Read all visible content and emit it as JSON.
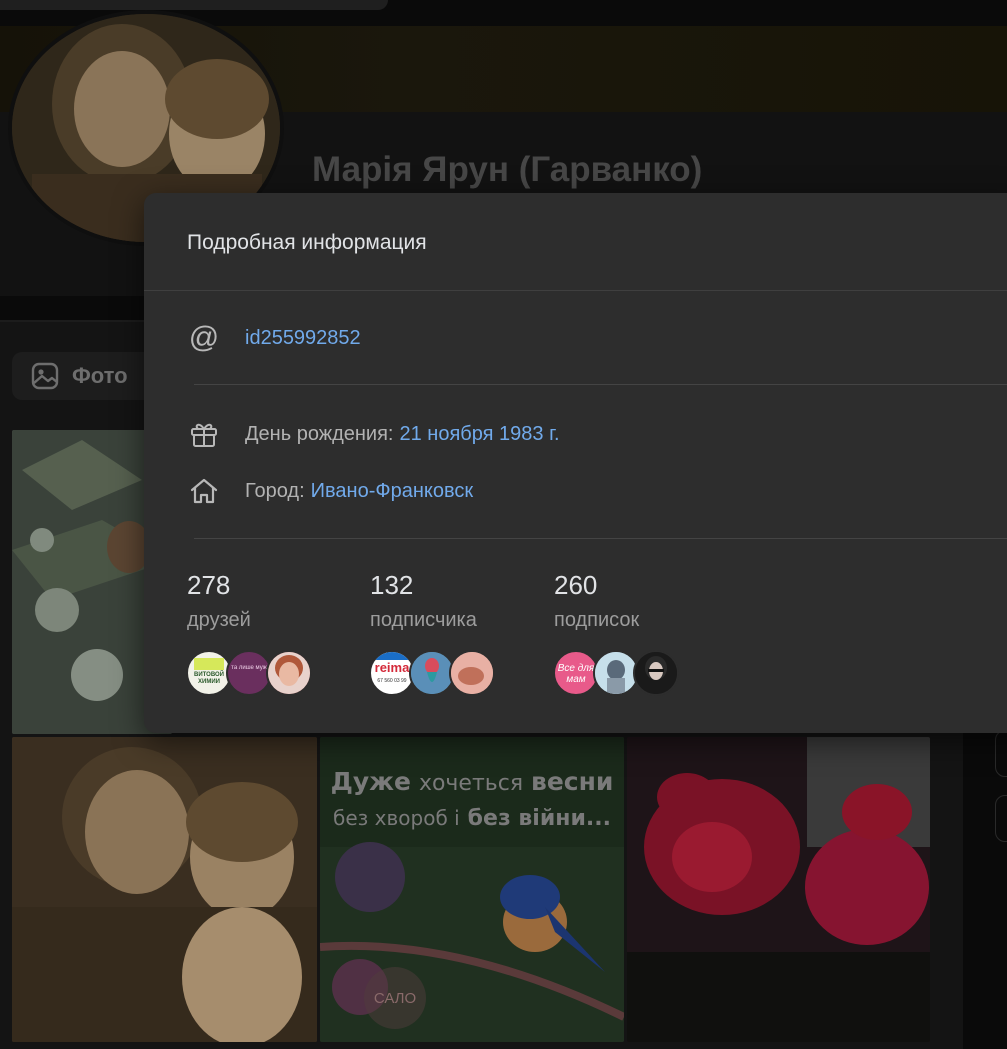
{
  "profile": {
    "name": "Марія Ярун (Гарванко)"
  },
  "tabs": {
    "photo_label": "Фото"
  },
  "photo_post": {
    "line1_bold_a": "Дуже",
    "line1_regular": "хочеться",
    "line1_bold_b": "весни",
    "line2_regular": "без хвороб і",
    "line2_bold": "без війни...",
    "watermark": "САЛО"
  },
  "modal": {
    "title": "Подробная информация",
    "username": "id255992852",
    "birthday_label": "День рождения:",
    "birthday_value": "21 ноября 1983 г.",
    "city_label": "Город:",
    "city_value": "Ивано-Франковск",
    "stats": [
      {
        "count": "278",
        "label": "друзей"
      },
      {
        "count": "132",
        "label": "подписчика"
      },
      {
        "count": "260",
        "label": "подписок"
      }
    ],
    "friend_avatar_texts": {
      "a1": "ВИТОВОЙ ХИМИИ",
      "a2": "та лише муж"
    },
    "follower_avatar_texts": {
      "a1": "reima",
      "a1_phone": "67 560 03 99"
    },
    "following_avatar_texts": {
      "a1": "Все для мам"
    }
  },
  "colors": {
    "accent": "#71aaeb",
    "modal_bg": "#2d2d2d",
    "page_bg": "#0a0a0a"
  }
}
